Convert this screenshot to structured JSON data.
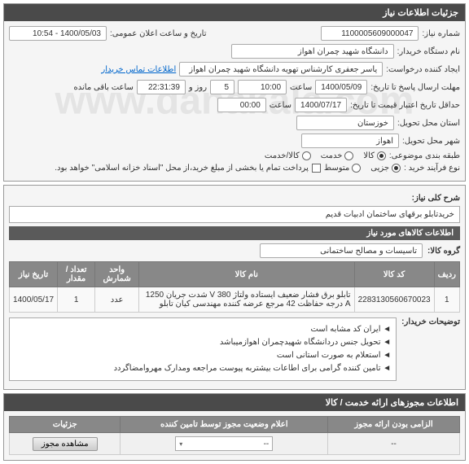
{
  "panel1": {
    "title": "جزئیات اطلاعات نیاز",
    "req_no_label": "شماره نیاز:",
    "req_no": "1100005609000047",
    "pub_date_label": "تاریخ و ساعت اعلان عمومی:",
    "pub_date": "1400/05/03 - 10:54",
    "org_label": "نام دستگاه خریدار:",
    "org": "دانشگاه شهید چمران اهواز",
    "creator_label": "ایجاد کننده درخواست:",
    "creator": "یاسر جعفری کارشناس تهویه دانشگاه شهید چمران اهواز",
    "contact_link": "اطلاعات تماس خریدار",
    "deadline_label": "مهلت ارسال پاسخ تا تاریخ:",
    "deadline_date": "1400/05/09",
    "time_label": "ساعت",
    "deadline_time": "10:00",
    "days_label": "روز و",
    "days": "5",
    "remain": "22:31:39",
    "remain_label": "ساعت باقی مانده",
    "validity_label": "حداقل تاریخ اعتبار قیمت تا تاریخ:",
    "validity_date": "1400/07/17",
    "validity_time": "00:00",
    "province_label": "استان محل تحویل:",
    "province": "خوزستان",
    "city_label": "شهر محل تحویل:",
    "city": "اهواز",
    "class_label": "طبقه بندی موضوعی:",
    "class_goods": "کالا",
    "class_service": "خدمت",
    "class_both": "کالا/خدمت",
    "type_label": "نوع فرآیند خرید :",
    "type_partial": "جزیی",
    "type_medium": "متوسط",
    "payment_note": "پرداخت تمام یا بخشی از مبلغ خرید،از محل \"اسناد خزانه اسلامی\" خواهد بود."
  },
  "panel2": {
    "desc_label": "شرح کلی نیاز:",
    "desc": "خریدتابلو برقهای ساختمان ادبیات قدیم",
    "sub_title": "اطلاعات کالاهای مورد نیاز",
    "group_label": "گروه کالا:",
    "group": "تاسیسات و مصالح ساختمانی",
    "watermark": "www.danakala.com",
    "table": {
      "headers": [
        "ردیف",
        "کد کالا",
        "نام کالا",
        "واحد شمارش",
        "تعداد / مقدار",
        "تاریخ نیاز"
      ],
      "rows": [
        {
          "idx": "1",
          "code": "2283130560670023",
          "name": "تابلو برق فشار ضعیف ایستاده ولتاژ 380 V شدت جریان 1250 A درجه حفاظت 42 مرجع عرضه کننده مهندسی کیان تابلو",
          "unit": "عدد",
          "qty": "1",
          "date": "1400/05/17"
        }
      ]
    },
    "buyer_notes_label": "توضیحات خریدار:",
    "buyer_notes": [
      "ایران کد مشابه است",
      "تحویل جنس دردانشگاه شهیدچمران اهوازمیباشد",
      "استعلام به صورت استانی است",
      "تامین کننده گرامی برای اطاعات بیشتربه پیوست مراجعه ومدارک مهروامضاگردد"
    ]
  },
  "panel3": {
    "title": "اطلاعات مجوزهای ارائه خدمت / کالا",
    "headers": [
      "الزامی بودن ارائه مجوز",
      "اعلام وضعیت مجوز توسط تامین کننده",
      "جزئیات"
    ],
    "mandatory": "--",
    "status": "--",
    "btn": "مشاهده مجوز"
  }
}
